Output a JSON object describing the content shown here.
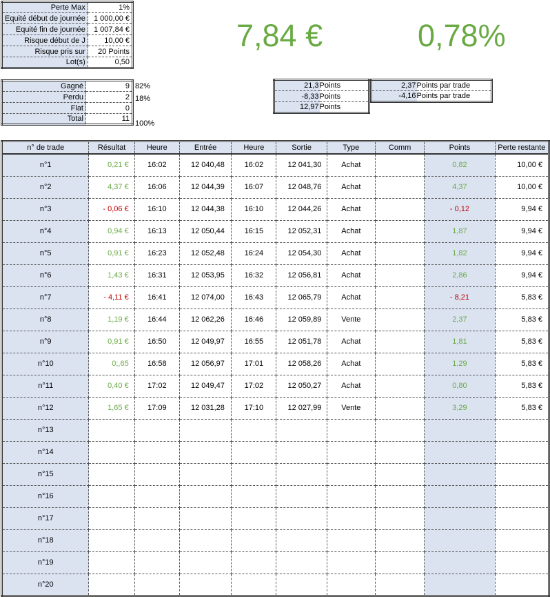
{
  "summary": [
    {
      "label": "Perte Max",
      "value": "1%"
    },
    {
      "label": "Equité début de journée",
      "value": "1 000,00 €"
    },
    {
      "label": "Equité fin de journée",
      "value": "1 007,84 €"
    },
    {
      "label": "Risque début de J",
      "value": "10,00 €"
    },
    {
      "label": "Risque pris sur",
      "value": "20 Points"
    },
    {
      "label": "Lot(s)",
      "value": "0,50"
    }
  ],
  "headline": {
    "gain": "7,84 €",
    "gain_pct": "0,78%"
  },
  "stats": [
    {
      "label": "Gagné",
      "value": "9",
      "pct": "82%"
    },
    {
      "label": "Perdu",
      "value": "2",
      "pct": "18%"
    },
    {
      "label": "Flat",
      "value": "0",
      "pct": ""
    },
    {
      "label": "Total",
      "value": "11",
      "pct": "100%"
    }
  ],
  "points": [
    {
      "value": "21,3",
      "unit": "Points"
    },
    {
      "value": "-8,33",
      "unit": "Points"
    },
    {
      "value": "12,97",
      "unit": "Points"
    }
  ],
  "per_trade": [
    {
      "value": "2,37",
      "unit": "Points par trade"
    },
    {
      "value": "-4,16",
      "unit": "Points par trade"
    }
  ],
  "columns": [
    "n° de trade",
    "Résultat",
    "Heure",
    "Entrée",
    "Heure",
    "Sortie",
    "Type",
    "Comm",
    "Points",
    "Perte restante"
  ],
  "trades": [
    {
      "n": "n°1",
      "res": "0,21 €",
      "s": "pos",
      "h1": "16:02",
      "in": "12 040,48",
      "h2": "16:02",
      "out": "12 041,30",
      "type": "Achat",
      "comm": "",
      "pts": "0,82",
      "perte": "10,00 €"
    },
    {
      "n": "n°2",
      "res": "4,37 €",
      "s": "pos",
      "h1": "16:06",
      "in": "12 044,39",
      "h2": "16:07",
      "out": "12 048,76",
      "type": "Achat",
      "comm": "",
      "pts": "4,37",
      "perte": "10,00 €"
    },
    {
      "n": "n°3",
      "res": "- 0,06 €",
      "s": "neg",
      "h1": "16:10",
      "in": "12 044,38",
      "h2": "16:10",
      "out": "12 044,26",
      "type": "Achat",
      "comm": "",
      "pts": "- 0,12",
      "perte": "9,94 €"
    },
    {
      "n": "n°4",
      "res": "0,94 €",
      "s": "pos",
      "h1": "16:13",
      "in": "12 050,44",
      "h2": "16:15",
      "out": "12 052,31",
      "type": "Achat",
      "comm": "",
      "pts": "1,87",
      "perte": "9,94 €"
    },
    {
      "n": "n°5",
      "res": "0,91 €",
      "s": "pos",
      "h1": "16:23",
      "in": "12 052,48",
      "h2": "16:24",
      "out": "12 054,30",
      "type": "Achat",
      "comm": "",
      "pts": "1,82",
      "perte": "9,94 €"
    },
    {
      "n": "n°6",
      "res": "1,43 €",
      "s": "pos",
      "h1": "16:31",
      "in": "12 053,95",
      "h2": "16:32",
      "out": "12 056,81",
      "type": "Achat",
      "comm": "",
      "pts": "2,86",
      "perte": "9,94 €"
    },
    {
      "n": "n°7",
      "res": "- 4,11 €",
      "s": "neg",
      "h1": "16:41",
      "in": "12 074,00",
      "h2": "16:43",
      "out": "12 065,79",
      "type": "Achat",
      "comm": "",
      "pts": "- 8,21",
      "perte": "5,83 €"
    },
    {
      "n": "n°8",
      "res": "1,19 €",
      "s": "pos",
      "h1": "16:44",
      "in": "12 062,26",
      "h2": "16:46",
      "out": "12 059,89",
      "type": "Vente",
      "comm": "",
      "pts": "2,37",
      "perte": "5,83 €"
    },
    {
      "n": "n°9",
      "res": "0,91 €",
      "s": "pos",
      "h1": "16:50",
      "in": "12 049,97",
      "h2": "16:55",
      "out": "12 051,78",
      "type": "Achat",
      "comm": "",
      "pts": "1,81",
      "perte": "5,83 €"
    },
    {
      "n": "n°10",
      "res": "0;,65",
      "s": "pos",
      "h1": "16:58",
      "in": "12 056,97",
      "h2": "17:01",
      "out": "12 058,26",
      "type": "Achat",
      "comm": "",
      "pts": "1,29",
      "perte": "5,83 €"
    },
    {
      "n": "n°11",
      "res": "0,40 €",
      "s": "pos",
      "h1": "17:02",
      "in": "12 049,47",
      "h2": "17:02",
      "out": "12 050,27",
      "type": "Achat",
      "comm": "",
      "pts": "0,80",
      "perte": "5,83 €"
    },
    {
      "n": "n°12",
      "res": "1,65 €",
      "s": "pos",
      "h1": "17:09",
      "in": "12 031,28",
      "h2": "17:10",
      "out": "12 027,99",
      "type": "Vente",
      "comm": "",
      "pts": "3,29",
      "perte": "5,83 €"
    },
    {
      "n": "n°13",
      "res": "",
      "s": "",
      "h1": "",
      "in": "",
      "h2": "",
      "out": "",
      "type": "",
      "comm": "",
      "pts": "",
      "perte": ""
    },
    {
      "n": "n°14",
      "res": "",
      "s": "",
      "h1": "",
      "in": "",
      "h2": "",
      "out": "",
      "type": "",
      "comm": "",
      "pts": "",
      "perte": ""
    },
    {
      "n": "n°15",
      "res": "",
      "s": "",
      "h1": "",
      "in": "",
      "h2": "",
      "out": "",
      "type": "",
      "comm": "",
      "pts": "",
      "perte": ""
    },
    {
      "n": "n°16",
      "res": "",
      "s": "",
      "h1": "",
      "in": "",
      "h2": "",
      "out": "",
      "type": "",
      "comm": "",
      "pts": "",
      "perte": ""
    },
    {
      "n": "n°17",
      "res": "",
      "s": "",
      "h1": "",
      "in": "",
      "h2": "",
      "out": "",
      "type": "",
      "comm": "",
      "pts": "",
      "perte": ""
    },
    {
      "n": "n°18",
      "res": "",
      "s": "",
      "h1": "",
      "in": "",
      "h2": "",
      "out": "",
      "type": "",
      "comm": "",
      "pts": "",
      "perte": ""
    },
    {
      "n": "n°19",
      "res": "",
      "s": "",
      "h1": "",
      "in": "",
      "h2": "",
      "out": "",
      "type": "",
      "comm": "",
      "pts": "",
      "perte": ""
    },
    {
      "n": "n°20",
      "res": "",
      "s": "",
      "h1": "",
      "in": "",
      "h2": "",
      "out": "",
      "type": "",
      "comm": "",
      "pts": "",
      "perte": ""
    }
  ],
  "colors": {
    "positive": "#6aaa45",
    "negative": "#c00000",
    "header_fill": "#dbe3f1"
  }
}
